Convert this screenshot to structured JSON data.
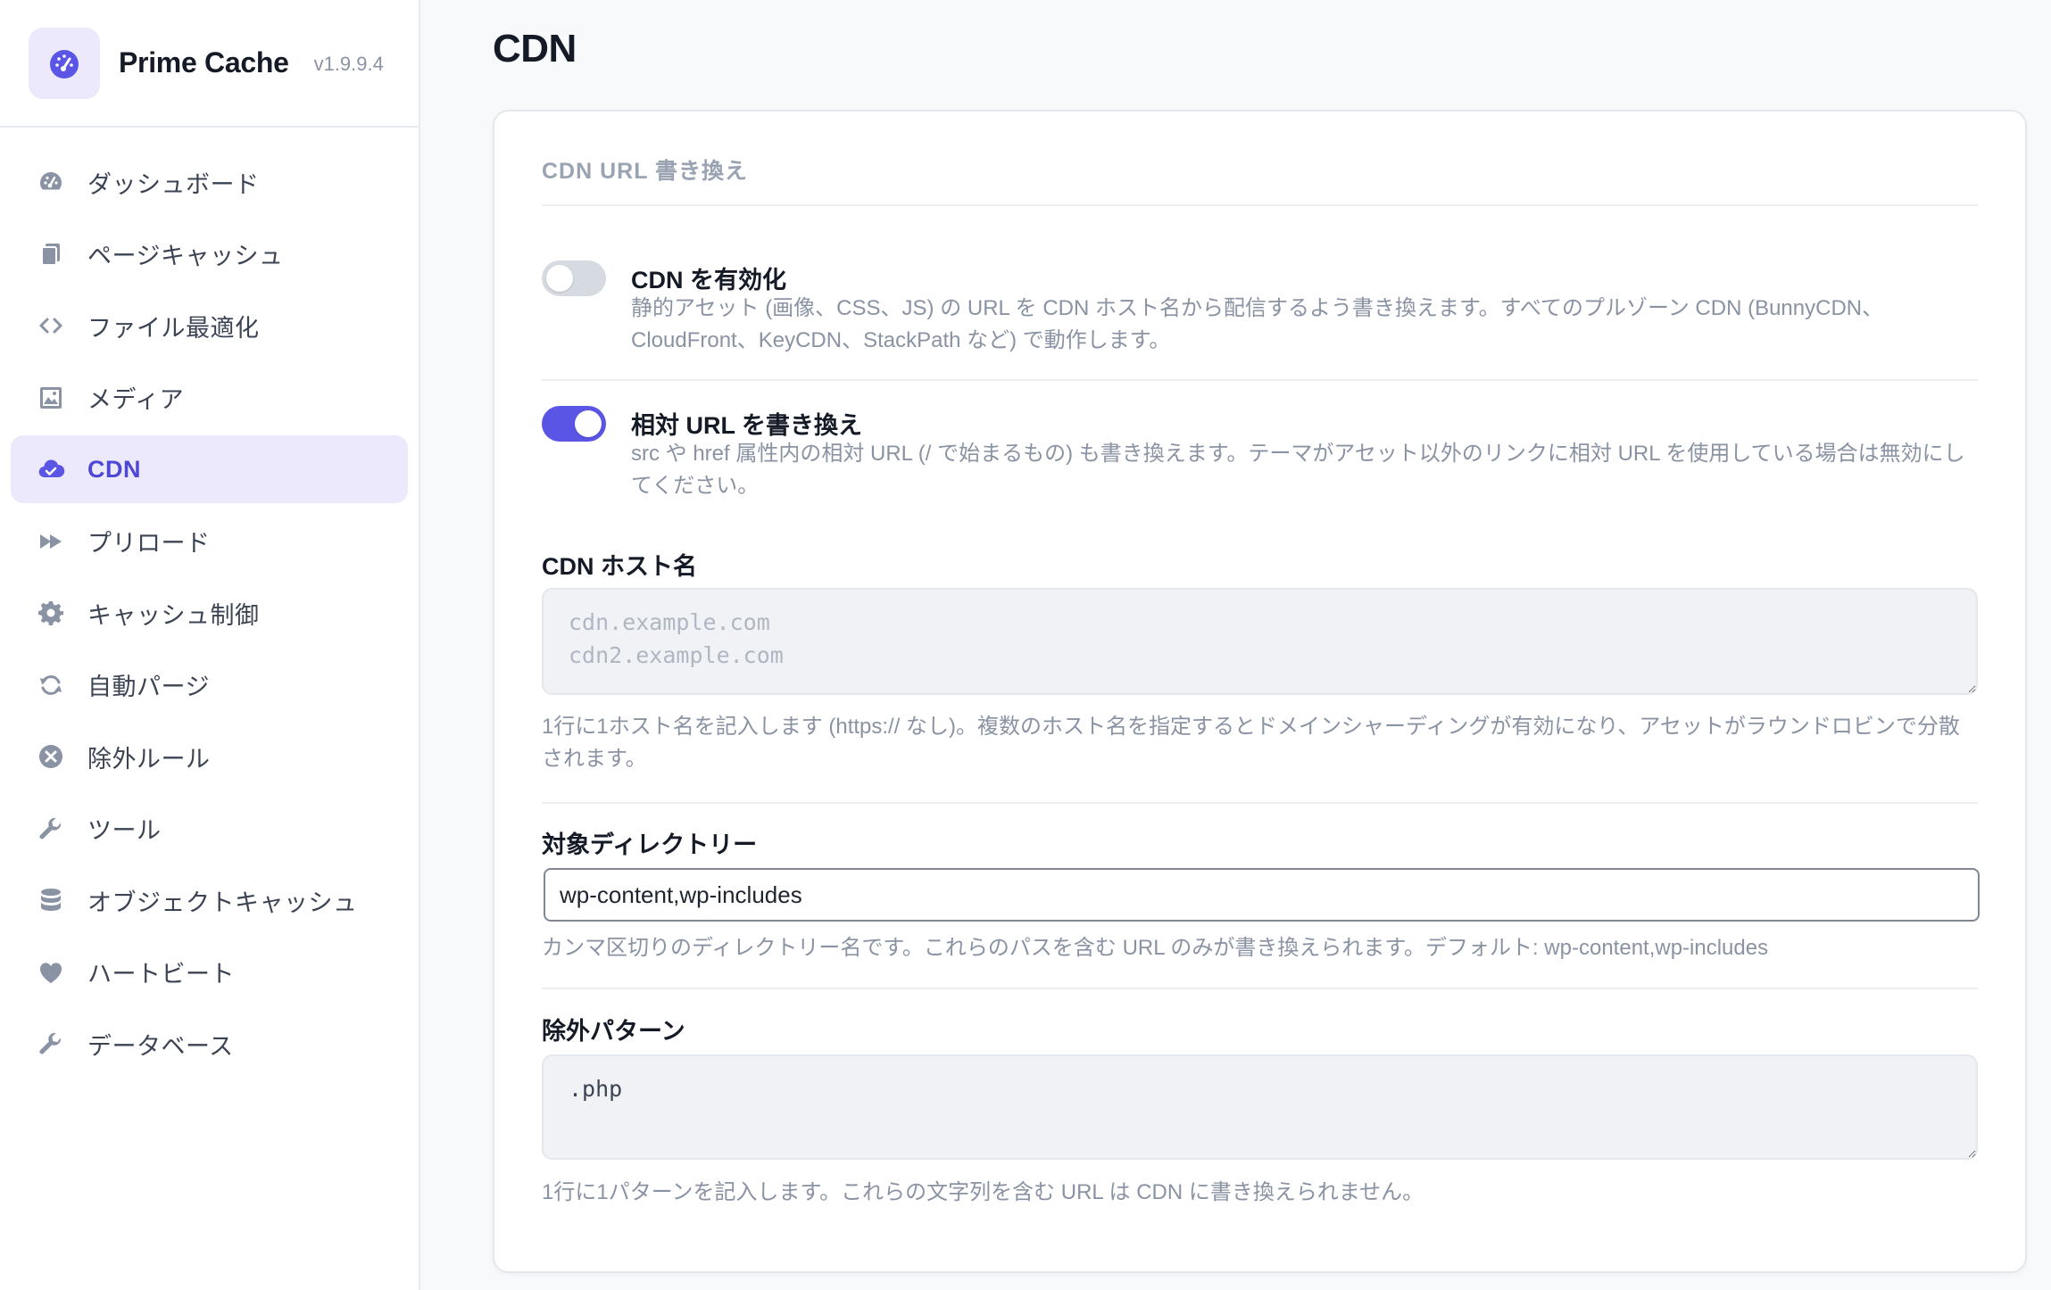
{
  "brand": {
    "name": "Prime Cache",
    "version": "v1.9.9.4",
    "logo_icon": "speedometer-icon"
  },
  "nav": {
    "items": [
      {
        "label": "ダッシュボード",
        "icon": "dashboard-icon"
      },
      {
        "label": "ページキャッシュ",
        "icon": "pages-icon"
      },
      {
        "label": "ファイル最適化",
        "icon": "code-icon"
      },
      {
        "label": "メディア",
        "icon": "image-icon"
      },
      {
        "label": "CDN",
        "icon": "cloud-icon",
        "active": true
      },
      {
        "label": "プリロード",
        "icon": "fast-forward-icon"
      },
      {
        "label": "キャッシュ制御",
        "icon": "gear-icon"
      },
      {
        "label": "自動パージ",
        "icon": "refresh-icon"
      },
      {
        "label": "除外ルール",
        "icon": "x-circle-icon"
      },
      {
        "label": "ツール",
        "icon": "wrench-icon"
      },
      {
        "label": "オブジェクトキャッシュ",
        "icon": "database-icon"
      },
      {
        "label": "ハートビート",
        "icon": "heart-icon"
      },
      {
        "label": "データベース",
        "icon": "wrench-icon"
      }
    ]
  },
  "page": {
    "title": "CDN"
  },
  "card": {
    "heading": "CDN URL 書き換え",
    "enable_cdn": {
      "title": "CDN を有効化",
      "description": "静的アセット (画像、CSS、JS) の URL を CDN ホスト名から配信するよう書き換えます。すべてのプルゾーン CDN (BunnyCDN、CloudFront、KeyCDN、StackPath など) で動作します。",
      "enabled": false
    },
    "relative_urls": {
      "title": "相対 URL を書き換え",
      "description": "src や href 属性内の相対 URL (/ で始まるもの) も書き換えます。テーマがアセット以外のリンクに相対 URL を使用している場合は無効にしてください。",
      "enabled": true
    },
    "hostnames": {
      "label": "CDN ホスト名",
      "placeholder": "cdn.example.com\ncdn2.example.com",
      "value": "",
      "help": "1行に1ホスト名を記入します (https:// なし)。複数のホスト名を指定するとドメインシャーディングが有効になり、アセットがラウンドロビンで分散されます。"
    },
    "directories": {
      "label": "対象ディレクトリー",
      "value": "wp-content,wp-includes",
      "help": "カンマ区切りのディレクトリー名です。これらのパスを含む URL のみが書き換えられます。デフォルト: wp-content,wp-includes"
    },
    "exclusions": {
      "label": "除外パターン",
      "value": ".php",
      "help": "1行に1パターンを記入します。これらの文字列を含む URL は CDN に書き換えられません。"
    }
  },
  "colors": {
    "accent": "#5b55e6",
    "active_bg": "#ebe9fb",
    "muted_text": "#8a93a3"
  }
}
